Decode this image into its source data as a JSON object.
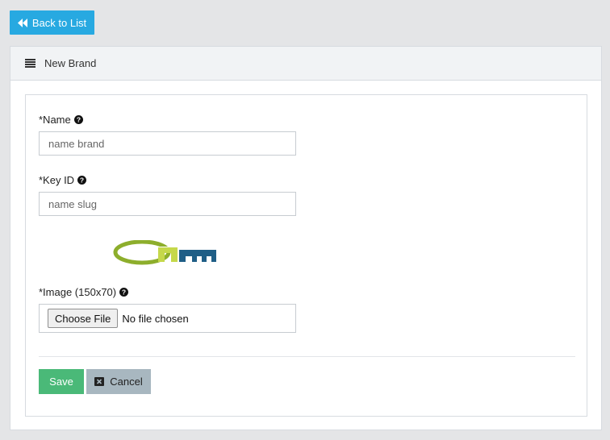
{
  "toolbar": {
    "back_label": "Back to List",
    "back_icon": "double-chevron-left-icon"
  },
  "panel": {
    "title": "New Brand",
    "header_icon": "list-icon"
  },
  "form": {
    "name": {
      "label": "*Name",
      "placeholder": "name brand",
      "value": ""
    },
    "key_id": {
      "label": "*Key ID",
      "placeholder": "name slug",
      "value": ""
    },
    "image": {
      "label": "*Image (150x70)",
      "choose_label": "Choose File",
      "status": "No file chosen"
    },
    "save_label": "Save",
    "cancel_label": "Cancel"
  },
  "colors": {
    "accent": "#27a9e1",
    "save": "#4ab978",
    "cancel": "#a8b7c0",
    "logo_green": "#8dae2c",
    "logo_blue": "#1f5e86"
  }
}
